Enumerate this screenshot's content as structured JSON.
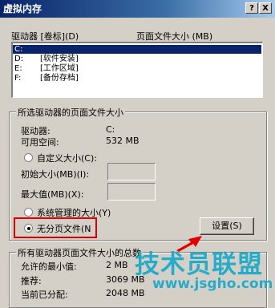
{
  "window": {
    "title": "虚拟内存",
    "help_label": "?",
    "close_label": "X"
  },
  "list_header": {
    "drive_col": "驱动器 [卷标](D)",
    "pagefile_col": "页面文件大小 (MB)"
  },
  "drives": [
    {
      "letter": "C:",
      "label": ""
    },
    {
      "letter": "D:",
      "label": "[软件安装]"
    },
    {
      "letter": "E:",
      "label": "[工作区域]"
    },
    {
      "letter": "F:",
      "label": "[备份存档]"
    }
  ],
  "selected_group": {
    "title": "所选驱动器的页面文件大小",
    "drive_label": "驱动器:",
    "drive_value": "C:",
    "space_label": "可用空间:",
    "space_value": "532 MB",
    "custom_size": "自定义大小(C):",
    "initial_size": "初始大小(MB)(I):",
    "max_size": "最大值(MB)(X):",
    "system_managed": "系统管理的大小(Y)",
    "no_paging": "无分页文件(N",
    "set_button": "设置(S)",
    "selected_option": "no_paging"
  },
  "all_group": {
    "title": "所有驱动器页面文件大小的总数",
    "min_label": "允许的最小值:",
    "min_value": "2 MB",
    "recommended_label": "推荐:",
    "recommended_value": "3069 MB",
    "current_label": "当前已分配:",
    "current_value": "2048 MB"
  },
  "watermark": {
    "text": "技术员联盟",
    "url": "www.jsgho.com"
  },
  "colors": {
    "highlight": "#e00000",
    "accent_arrow": "#e00000",
    "watermark": "#18a8c8"
  }
}
